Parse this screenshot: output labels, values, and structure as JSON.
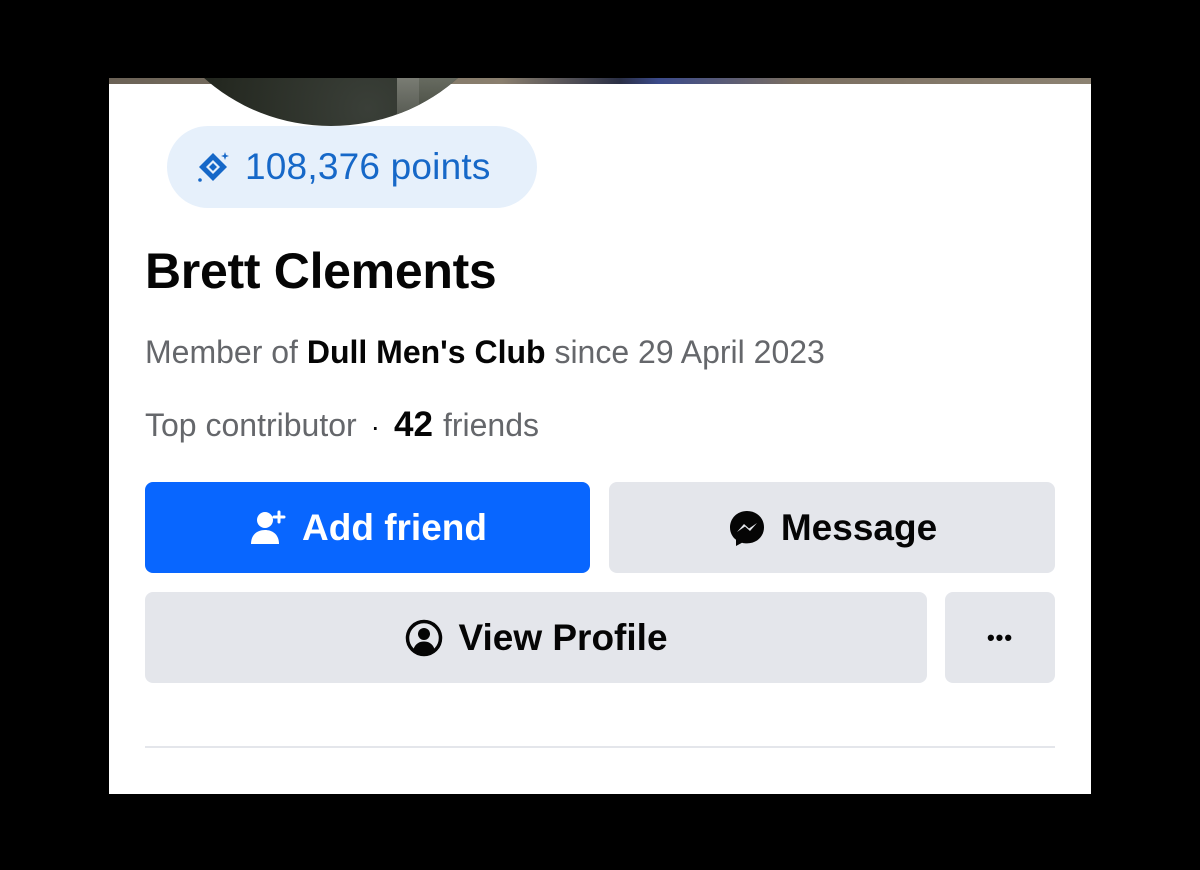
{
  "profile": {
    "points_label": "108,376 points",
    "name": "Brett Clements",
    "member_prefix": "Member of",
    "group_name": "Dull Men's Club",
    "member_since": "since 29 April 2023",
    "badge": "Top contributor",
    "separator": "·",
    "friend_count": "42",
    "friends_label": "friends"
  },
  "actions": {
    "add_friend_label": "Add friend",
    "message_label": "Message",
    "view_profile_label": "View Profile",
    "more_label": "•••"
  },
  "icons": {
    "points": "diamond-points-icon",
    "add_friend": "add-person-icon",
    "message": "messenger-icon",
    "view_profile": "user-circle-icon"
  },
  "colors": {
    "primary": "#0866ff",
    "points_text": "#1668c8",
    "points_bg": "#e6f0fb",
    "secondary_button": "#e4e6eb",
    "muted_text": "#65676b"
  }
}
